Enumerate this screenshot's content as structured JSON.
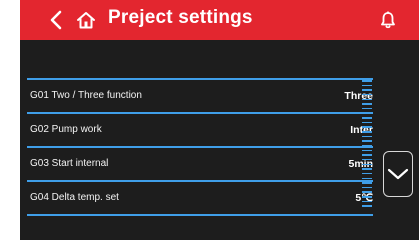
{
  "colors": {
    "header": "#e3262f",
    "panel": "#1d1d1d",
    "accent": "#3f9ee8",
    "text": "#ffffff"
  },
  "header": {
    "title": "Preject settings",
    "back_icon": "chevron-left-icon",
    "home_icon": "home-icon",
    "bell_icon": "bell-icon"
  },
  "settings": [
    {
      "label": "G01 Two / Three function",
      "value": "Three"
    },
    {
      "label": "G02 Pump work",
      "value": "Inter"
    },
    {
      "label": "G03 Start internal",
      "value": "5min"
    },
    {
      "label": "G04 Delta temp. set",
      "value": "5℃"
    }
  ],
  "controls": {
    "scroll_down_icon": "chevron-down-icon"
  }
}
